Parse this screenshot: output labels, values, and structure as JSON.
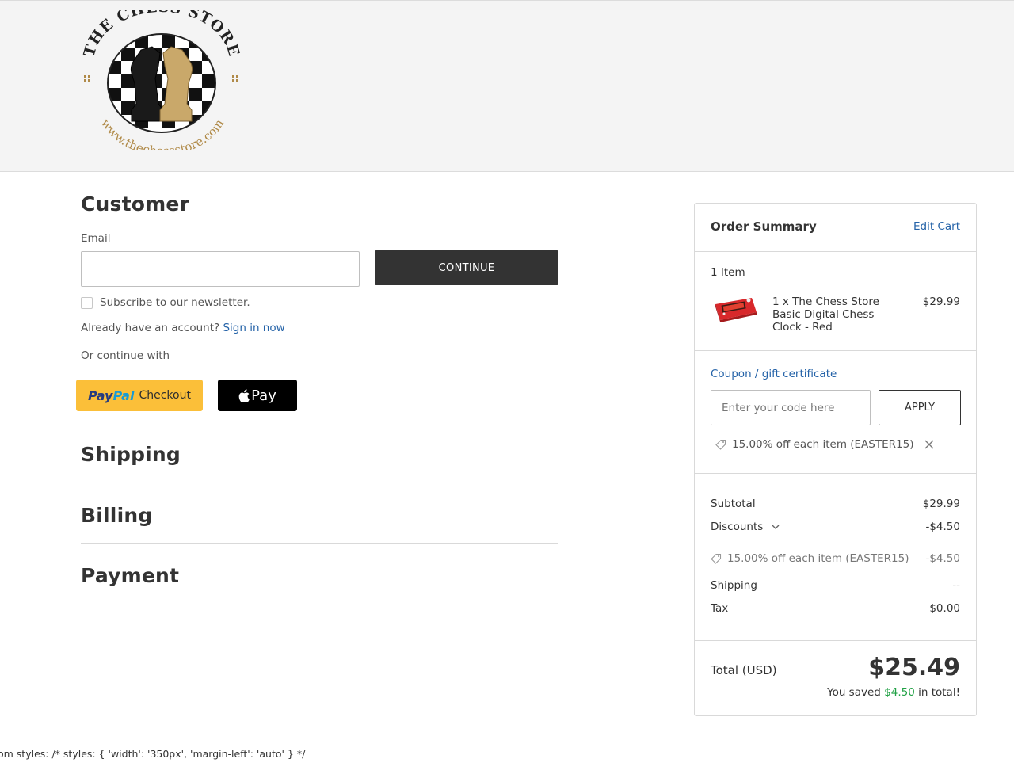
{
  "brand": {
    "name_text": "THE CHESS STORE",
    "url_text": "www.thechessstore.com"
  },
  "customer": {
    "title": "Customer",
    "email_label": "Email",
    "email_value": "",
    "continue_label": "CONTINUE",
    "newsletter_label": "Subscribe to our newsletter.",
    "account_prompt": "Already have an account?",
    "sign_in_label": "Sign in now",
    "or_continue": "Or continue with",
    "paypal_label": {
      "pay": "Pay",
      "pal": "Pal",
      "checkout": "Checkout"
    },
    "applepay_label": "Pay"
  },
  "sections": {
    "shipping": "Shipping",
    "billing": "Billing",
    "payment": "Payment"
  },
  "summary": {
    "title": "Order Summary",
    "edit_cart": "Edit Cart",
    "item_count": "1 Item",
    "item": {
      "name": "1 x The Chess Store Basic Digital Chess Clock - Red",
      "price": "$29.99"
    },
    "coupon_link": "Coupon / gift certificate",
    "coupon_placeholder": "Enter your code here",
    "apply_label": "APPLY",
    "applied_coupon": "15.00% off each item (EASTER15)",
    "subtotal_label": "Subtotal",
    "subtotal_value": "$29.99",
    "discounts_label": "Discounts",
    "discounts_value": "-$4.50",
    "discount_detail_label": "15.00% off each item (EASTER15)",
    "discount_detail_value": "-$4.50",
    "shipping_label": "Shipping",
    "shipping_value": "--",
    "tax_label": "Tax",
    "tax_value": "$0.00",
    "total_label": "Total (USD)",
    "total_value": "$25.49",
    "saved_prefix": "You saved",
    "saved_amount": "$4.50",
    "saved_suffix": "in total!"
  },
  "debug_text": "om styles: /* styles: { 'width': '350px', 'margin-left': 'auto' } */",
  "colors": {
    "accent_link": "#2563a8",
    "button_dark": "#333333",
    "paypal_yellow": "#fbbf39",
    "savings_green": "#21a145"
  }
}
